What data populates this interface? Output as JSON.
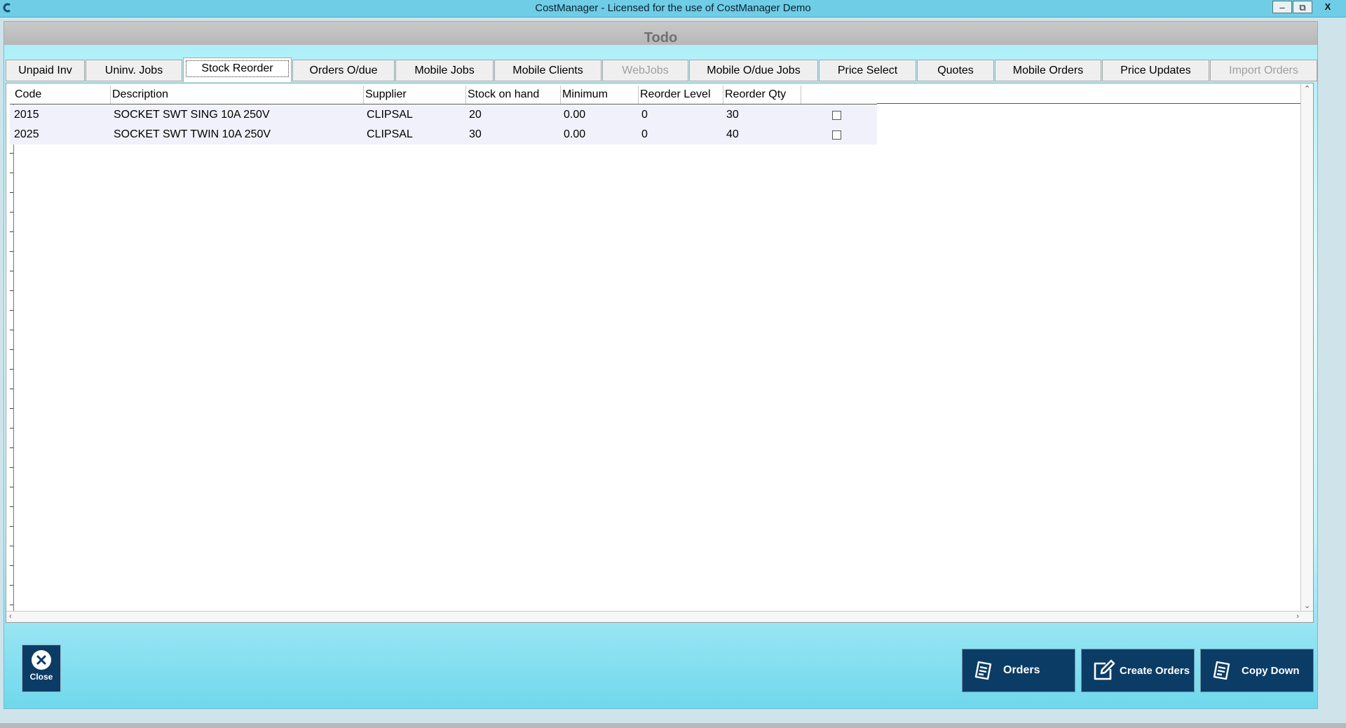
{
  "window": {
    "title": "CostManager - Licensed for the use of CostManager Demo",
    "controls": {
      "minimize": "‒",
      "restore": "⧉",
      "close": "X"
    }
  },
  "form": {
    "title": "Todo"
  },
  "tabs": [
    {
      "label": "Unpaid Inv",
      "state": "normal"
    },
    {
      "label": "Uninv. Jobs",
      "state": "normal"
    },
    {
      "label": "Stock Reorder",
      "state": "active"
    },
    {
      "label": "Orders O/due",
      "state": "normal"
    },
    {
      "label": "Mobile Jobs",
      "state": "normal"
    },
    {
      "label": "Mobile Clients",
      "state": "normal"
    },
    {
      "label": "WebJobs",
      "state": "disabled"
    },
    {
      "label": "Mobile O/due Jobs",
      "state": "normal"
    },
    {
      "label": "Price Select",
      "state": "normal"
    },
    {
      "label": "Quotes",
      "state": "normal"
    },
    {
      "label": "Mobile Orders",
      "state": "normal"
    },
    {
      "label": "Price Updates",
      "state": "normal"
    },
    {
      "label": "Import Orders",
      "state": "disabled"
    }
  ],
  "grid": {
    "columns": [
      "Code",
      "Description",
      "Supplier",
      "Stock on hand",
      "Minimum",
      "Reorder Level",
      "Reorder Qty",
      ""
    ],
    "rows": [
      {
        "code": "2015",
        "description": "SOCKET SWT SING 10A 250V",
        "supplier": "CLIPSAL",
        "stock_on_hand": "20",
        "minimum": "0.00",
        "reorder_level": "0",
        "reorder_qty": "30",
        "selected": false
      },
      {
        "code": "2025",
        "description": "SOCKET SWT TWIN 10A 250V",
        "supplier": "CLIPSAL",
        "stock_on_hand": "30",
        "minimum": "0.00",
        "reorder_level": "0",
        "reorder_qty": "40",
        "selected": false
      }
    ]
  },
  "buttons": {
    "close": "Close",
    "orders": "Orders",
    "create_orders": "Create Orders",
    "copy_down": "Copy Down"
  },
  "icons": {
    "app": "app-logo-icon",
    "close": "close-x-icon",
    "orders": "receipt-icon",
    "create_orders": "edit-document-icon",
    "copy_down": "receipt-icon"
  },
  "colors": {
    "titlebar": "#6fcde6",
    "button_bg": "#0b3c66",
    "row_bg": "#f1f1fb"
  }
}
